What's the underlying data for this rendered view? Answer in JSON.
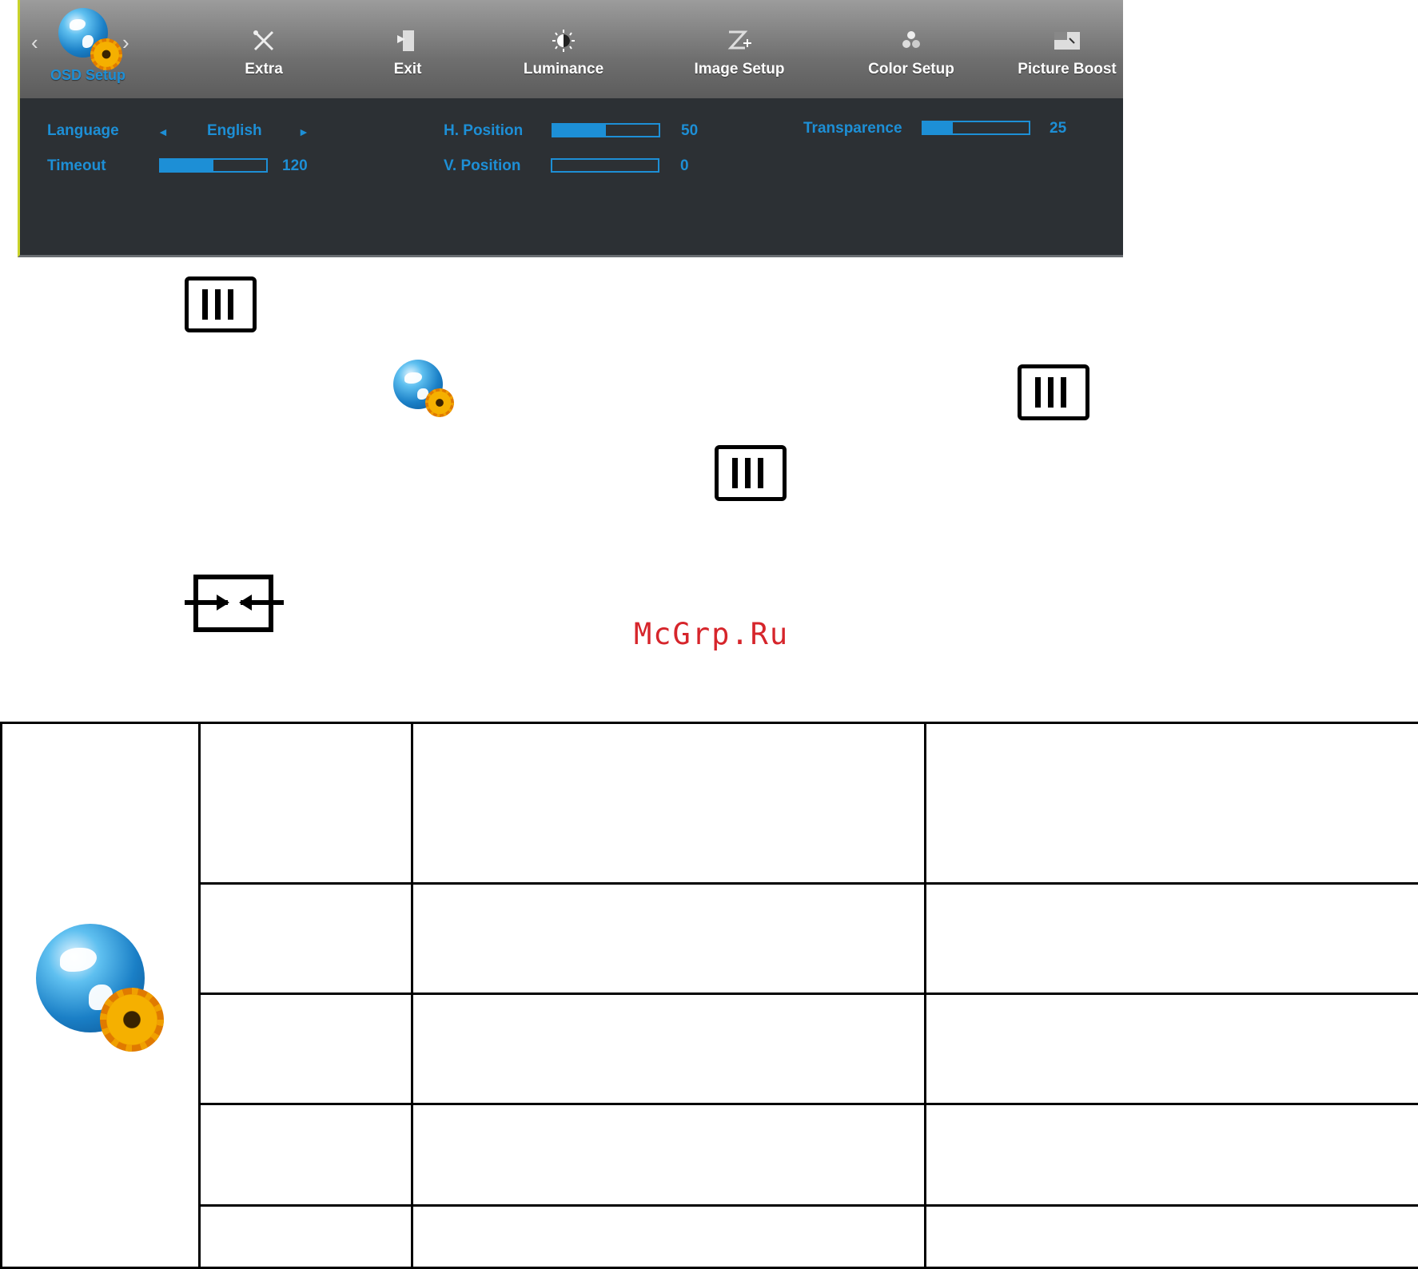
{
  "osd": {
    "tabs": [
      {
        "label": "OSD Setup",
        "icon": "osd-setup-icon",
        "active": true
      },
      {
        "label": "Extra",
        "icon": "extra-tools-icon"
      },
      {
        "label": "Exit",
        "icon": "exit-door-icon"
      },
      {
        "label": "Luminance",
        "icon": "luminance-sun-icon"
      },
      {
        "label": "Image Setup",
        "icon": "image-setup-icon"
      },
      {
        "label": "Color Setup",
        "icon": "color-setup-icon"
      },
      {
        "label": "Picture Boost",
        "icon": "picture-boost-icon"
      }
    ],
    "nav": {
      "left": "‹",
      "right": "›"
    },
    "settings": {
      "language": {
        "label": "Language",
        "value": "English",
        "left_arrow": "◄",
        "right_arrow": "►"
      },
      "timeout": {
        "label": "Timeout",
        "value": "120",
        "level": 0.5
      },
      "h_position": {
        "label": "H. Position",
        "value": "50",
        "level": 0.5
      },
      "v_position": {
        "label": "V. Position",
        "value": "0",
        "level": 0
      },
      "transparence": {
        "label": "Transparence",
        "value": "25",
        "level": 0.28
      }
    },
    "colors": {
      "accent": "#1d8fd6",
      "panel": "#2c3034",
      "border": "#c9d32a"
    }
  },
  "buttons": {
    "menu_icon": "menu-button-icon",
    "auto_icon": "auto-button-icon",
    "osd_icon": "osd-setup-icon"
  },
  "watermark": "McGrp.Ru"
}
